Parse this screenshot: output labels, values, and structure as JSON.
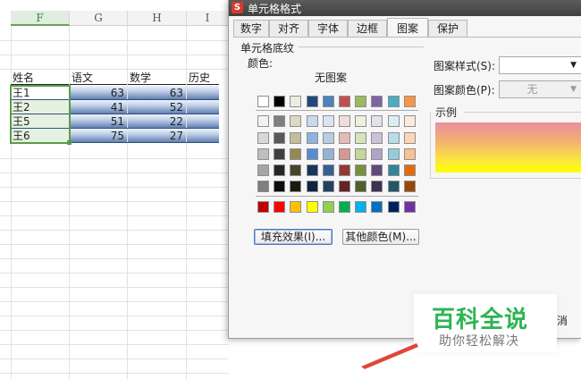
{
  "sheet": {
    "columns": [
      "F",
      "G",
      "H",
      "I"
    ],
    "headers": [
      "姓名",
      "语文",
      "数学",
      "历史"
    ],
    "rows": [
      {
        "name": "王1",
        "chinese": "63",
        "math": "63"
      },
      {
        "name": "王2",
        "chinese": "41",
        "math": "52"
      },
      {
        "name": "王5",
        "chinese": "51",
        "math": "22"
      },
      {
        "name": "王6",
        "chinese": "75",
        "math": "27"
      }
    ]
  },
  "dialog": {
    "logo_glyph": "S",
    "title": "单元格格式",
    "tabs": [
      "数字",
      "对齐",
      "字体",
      "边框",
      "图案",
      "保护"
    ],
    "active_tab": "图案",
    "shading_group": "单元格底纹",
    "color_label": "颜色:",
    "no_fill_label": "无图案",
    "palette": {
      "row1": [
        "#ffffff",
        "#000000",
        "#eeece1",
        "#1f497d",
        "#4f81bd",
        "#c0504d",
        "#9bbb59",
        "#8064a2",
        "#4bacc6",
        "#f79646"
      ],
      "row2": [
        "#f2f2f2",
        "#7f7f7f",
        "#ddd9c3",
        "#c6d9f0",
        "#dbe5f1",
        "#f2dcdb",
        "#ebf1dd",
        "#e5e0ec",
        "#dbeef3",
        "#fdeada"
      ],
      "row3": [
        "#d8d8d8",
        "#595959",
        "#c4bd97",
        "#8db3e2",
        "#b8cce4",
        "#e5b9b7",
        "#d7e3bc",
        "#ccc1d9",
        "#b7dde8",
        "#fbd5b5"
      ],
      "row4": [
        "#bfbfbf",
        "#3f3f3f",
        "#938953",
        "#548dd4",
        "#95b3d7",
        "#d99694",
        "#c3d69b",
        "#b2a2c7",
        "#92cddc",
        "#fac08f"
      ],
      "row5": [
        "#a5a5a5",
        "#262626",
        "#494429",
        "#17365d",
        "#366092",
        "#953734",
        "#76923c",
        "#5f497a",
        "#31859b",
        "#e36c09"
      ],
      "row6": [
        "#7f7f7f",
        "#0c0c0c",
        "#1d1b10",
        "#0f243e",
        "#244061",
        "#632423",
        "#4f6128",
        "#3f3151",
        "#205867",
        "#974806"
      ],
      "standard": [
        "#c00000",
        "#ff0000",
        "#ffc000",
        "#ffff00",
        "#92d050",
        "#00b050",
        "#00b0f0",
        "#0070c0",
        "#002060",
        "#7030a0"
      ]
    },
    "fill_effects_button": "填充效果(I)...",
    "more_colors_button": "其他颜色(M)...",
    "pattern_style_label": "图案样式(S):",
    "pattern_style_value": "",
    "pattern_color_label": "图案颜色(P):",
    "pattern_color_value": "无",
    "sample_label": "示例",
    "sample_gradient_colors": [
      "#ea8e9e",
      "#f3b36f",
      "#fbe73c",
      "#ffff00"
    ],
    "cancel_fragment": "消"
  },
  "watermark": {
    "title": "百科全说",
    "subtitle": "助你轻松解决",
    "brand_color": "#2db452"
  },
  "colors": {
    "selection_green": "#5a9b4b",
    "header_underline": "#222222",
    "annotation_arrow": "#e0463a"
  }
}
